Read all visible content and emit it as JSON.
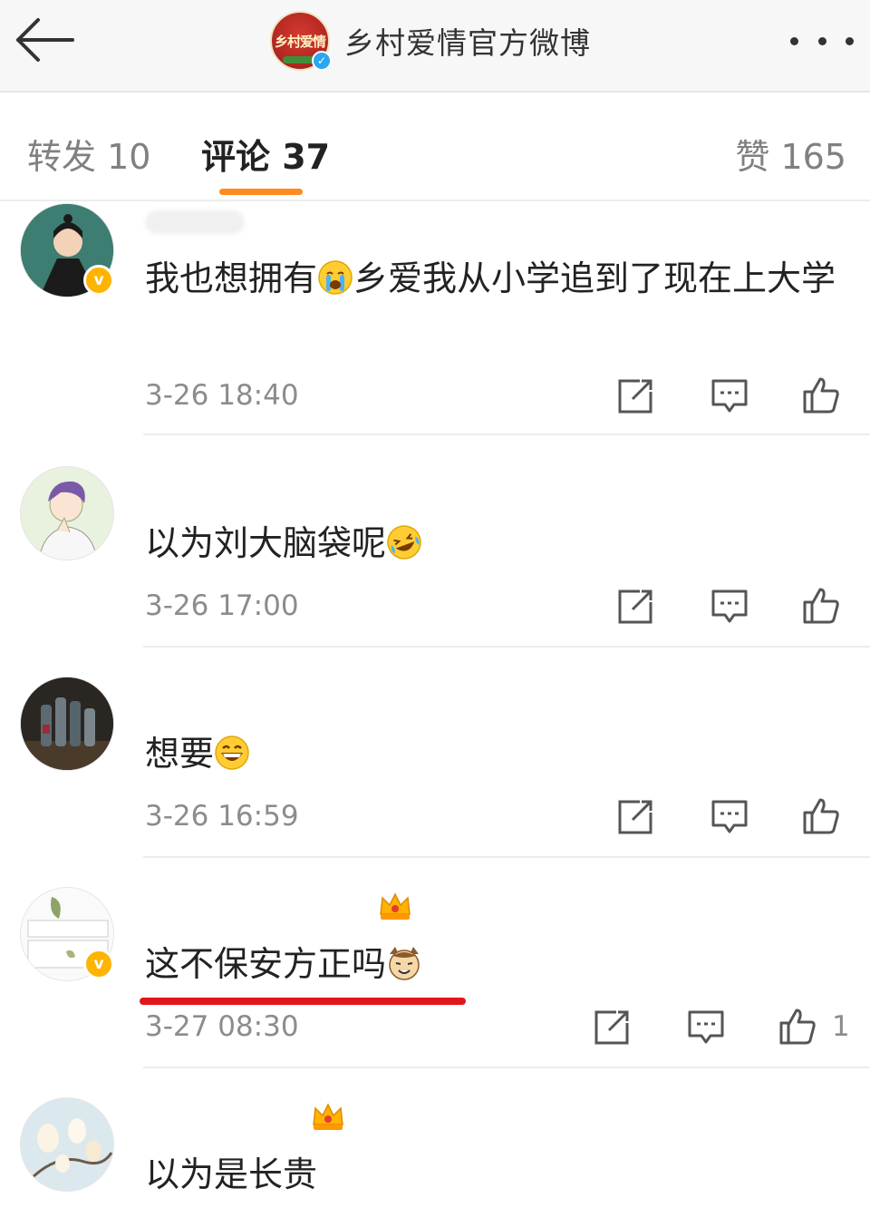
{
  "header": {
    "title": "乡村爱情官方微博",
    "logo_text": "乡村爱情"
  },
  "tabs": {
    "repost": "转发 10",
    "comments": "评论 37",
    "likes": "赞 165"
  },
  "comments": [
    {
      "text_before": "我也想拥有",
      "emoji": "crying-emoji",
      "text_after": "乡爱我从小学追到了现在上大学",
      "time": "3-26 18:40",
      "like_count": ""
    },
    {
      "text_before": "以为刘大脑袋呢",
      "emoji": "laughing-tears-emoji",
      "text_after": "",
      "time": "3-26 17:00",
      "like_count": ""
    },
    {
      "text_before": "想要",
      "emoji": "grin-emoji",
      "text_after": "",
      "time": "3-26 16:59",
      "like_count": ""
    },
    {
      "text_before": "这不保安方正吗",
      "emoji": "cat-face-emoji",
      "text_after": "",
      "time": "3-27 08:30",
      "like_count": "1"
    },
    {
      "text_before": "以为是长贵",
      "emoji": "",
      "text_after": "",
      "time": "",
      "like_count": ""
    }
  ],
  "colors": {
    "tab_accent": "#ff8a1f",
    "verified_badge": "#ffb400",
    "highlight_underline": "#e0161b"
  }
}
